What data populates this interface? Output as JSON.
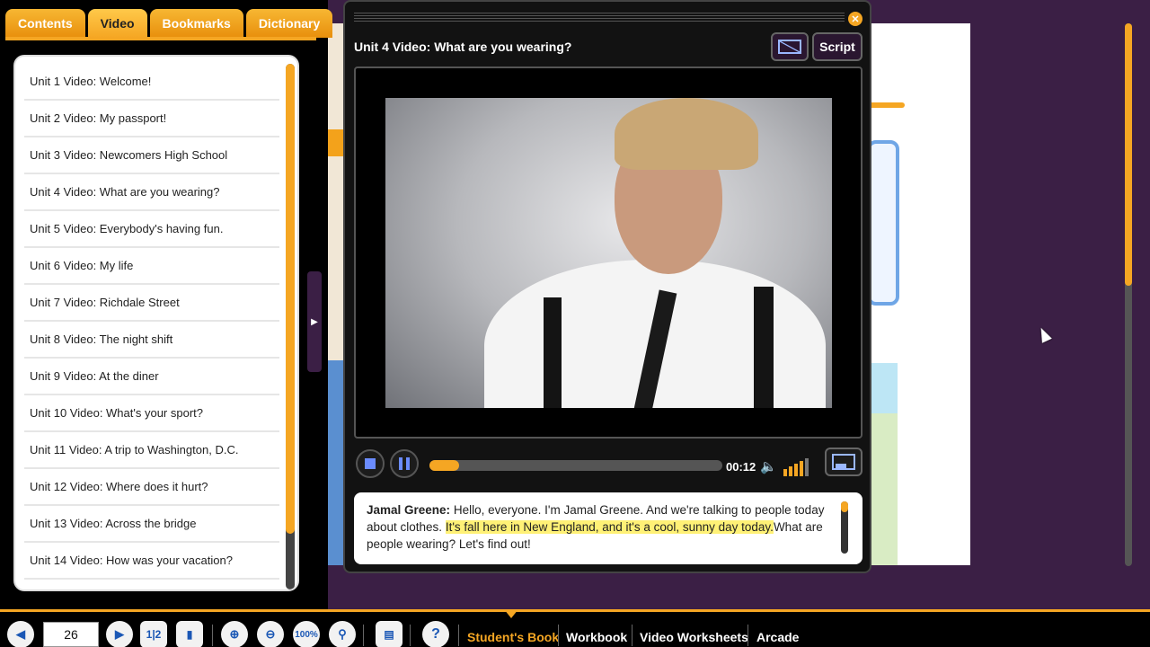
{
  "left_panel": {
    "tabs": [
      "Contents",
      "Video",
      "Bookmarks",
      "Dictionary"
    ],
    "active_tab": "Video",
    "video_list": [
      "Unit 1 Video:  Welcome!",
      "Unit 2 Video:  My passport!",
      "Unit 3 Video:  Newcomers High School",
      "Unit 4 Video:  What are you wearing?",
      "Unit 5 Video:  Everybody's having fun.",
      "Unit 6 Video:  My life",
      "Unit 7 Video:  Richdale Street",
      "Unit 8 Video:  The night shift",
      "Unit 9 Video:  At the diner",
      "Unit 10 Video:  What's your sport?",
      "Unit 11 Video:  A trip to Washington, D.C.",
      "Unit 12 Video:  Where does it hurt?",
      "Unit 13 Video:  Across the bridge",
      "Unit 14 Video:  How was your vacation?"
    ]
  },
  "video_player": {
    "title": "Unit 4 Video:  What are you wearing?",
    "script_label": "Script",
    "time": "00:12",
    "progress": 0.1,
    "volume_level": 4,
    "volume_max": 5,
    "transcript": {
      "speaker": "Jamal Greene:",
      "text_before": " Hello, everyone. I'm Jamal Greene. And we're talking to people today about clothes. ",
      "highlighted": "It's fall here in New England, and it's a cool, sunny day today.",
      "text_after": "What are people wearing? Let's find out!"
    }
  },
  "toolbar": {
    "page_number": "26",
    "zoom_label": "100%",
    "spread_label": "1|2",
    "help_label": "?",
    "links": [
      "Student's Book",
      "Workbook",
      "Video Worksheets",
      "Arcade"
    ],
    "active_link": "Student's Book"
  },
  "icons": {
    "close": "close-icon",
    "prev": "arrow-left-icon",
    "next": "arrow-right-icon",
    "bookmark": "bookmark-icon",
    "zoom_in": "zoom-in-icon",
    "zoom_out": "zoom-out-icon",
    "search": "search-icon",
    "toolbox": "toolbox-icon",
    "speaker": "speaker-icon",
    "fullscreen": "fullscreen-icon",
    "captions": "captions-icon"
  },
  "colors": {
    "accent": "#f5a623",
    "background": "#3b1f45",
    "highlight": "#fff176"
  }
}
